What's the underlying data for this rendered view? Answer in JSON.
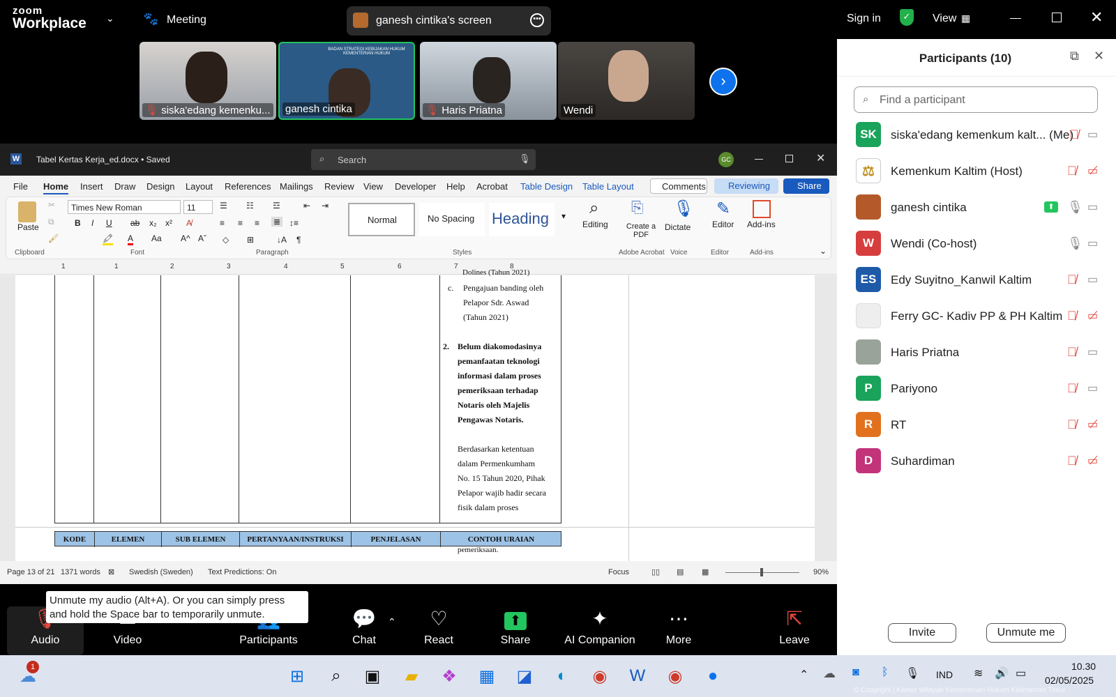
{
  "zoom": {
    "brand": "zoom",
    "app": "Workplace",
    "meeting_label": "Meeting",
    "share_title": "ganesh cintika's screen",
    "sign_in": "Sign in",
    "view": "View"
  },
  "videos": [
    {
      "name": "siska'edang kemenku..."
    },
    {
      "name": "ganesh cintika",
      "slide_text": "BADAN STRATEGI KEBIJAKAN HUKUM KEMENTERIAN HUKUM"
    },
    {
      "name": "Haris Priatna"
    },
    {
      "name": "Wendi"
    }
  ],
  "word": {
    "title": "Tabel Kertas Kerja_ed.docx • Saved",
    "search_placeholder": "Search",
    "avatar": "GC",
    "menu": [
      "File",
      "Home",
      "Insert",
      "Draw",
      "Design",
      "Layout",
      "References",
      "Mailings",
      "Review",
      "View",
      "Developer",
      "Help",
      "Acrobat",
      "Table Design",
      "Table Layout"
    ],
    "comments": "Comments",
    "reviewing": "Reviewing",
    "share": "Share",
    "font": "Times New Roman",
    "size": "11",
    "groups": {
      "clipboard": "Clipboard",
      "font": "Font",
      "paragraph": "Paragraph",
      "styles": "Styles",
      "adobe": "Adobe Acrobat",
      "voice": "Voice",
      "editor": "Editor",
      "addins": "Add-ins"
    },
    "paste": "Paste",
    "styles": [
      "Normal",
      "No Spacing",
      "Heading"
    ],
    "editing": "Editing",
    "create_pdf": "Create a PDF",
    "dictate": "Dictate",
    "editor_btn": "Editor",
    "addins_btn": "Add-ins",
    "ruler_nums": [
      "1",
      "1",
      "2",
      "3",
      "4",
      "5",
      "6",
      "7",
      "8"
    ],
    "doc": {
      "cut_line": "Dolines (Tahun 2021)",
      "item_c_label": "c.",
      "item_c_lines": [
        "Pengajuan banding oleh",
        "Pelapor Sdr. Aswad",
        "(Tahun 2021)"
      ],
      "item2_num": "2.",
      "item2_lines": [
        "Belum diakomodasinya",
        "pemanfaatan teknologi",
        "informasi dalam proses",
        "pemeriksaan terhadap",
        "Notaris oleh Majelis",
        "Pengawas Notaris."
      ],
      "para_lines": [
        "Berdasarkan ketentuan",
        "dalam Permenkumham",
        "No. 15 Tahun 2020, Pihak",
        "Pelapor wajib hadir secara",
        "fisik dalam proses"
      ],
      "headers": [
        "KODE",
        "ELEMEN",
        "SUB ELEMEN",
        "PERTANYAAN/INSTRUKSI",
        "PENJELASAN",
        "CONTOH URAIAN"
      ],
      "continued": "pemeriksaan."
    },
    "status": {
      "page": "Page 13 of 21",
      "words": "1371 words",
      "lang": "Swedish (Sweden)",
      "predictions": "Text Predictions: On",
      "focus": "Focus",
      "zoom": "90%"
    }
  },
  "tooltip": "Unmute my audio (Alt+A). Or you can simply press and hold the Space bar to temporarily unmute.",
  "toolbar": {
    "audio": "Audio",
    "video": "Video",
    "participants": "Participants",
    "participants_count": "10",
    "chat": "Chat",
    "react": "React",
    "share": "Share",
    "ai": "AI Companion",
    "more": "More",
    "leave": "Leave"
  },
  "panel": {
    "title": "Participants (10)",
    "search_placeholder": "Find a participant",
    "invite": "Invite",
    "unmute": "Unmute me"
  },
  "participants": [
    {
      "initials": "SK",
      "name": "siska'edang kemenkum kalt... (Me)",
      "color": "#1aa35a",
      "mic": "off",
      "video": "on"
    },
    {
      "initials": "",
      "name": "Kemenkum Kaltim (Host)",
      "color": "#ffffff",
      "mic": "off",
      "video": "off"
    },
    {
      "initials": "",
      "name": "ganesh cintika",
      "color": "#b45a2a",
      "mic": "on",
      "video": "on",
      "sharing": true
    },
    {
      "initials": "W",
      "name": "Wendi (Co-host)",
      "color": "#d63d3d",
      "mic": "on",
      "video": "on"
    },
    {
      "initials": "ES",
      "name": "Edy Suyitno_Kanwil Kaltim",
      "color": "#1e5aa8",
      "mic": "off",
      "video": "on"
    },
    {
      "initials": "",
      "name": "Ferry GC- Kadiv PP & PH Kaltim",
      "color": "#eeeeee",
      "mic": "off",
      "video": "off"
    },
    {
      "initials": "",
      "name": "Haris Priatna",
      "color": "#9aa39a",
      "mic": "off",
      "video": "on"
    },
    {
      "initials": "P",
      "name": "Pariyono",
      "color": "#1aa35a",
      "mic": "off",
      "video": "on"
    },
    {
      "initials": "R",
      "name": "RT",
      "color": "#e2711d",
      "mic": "off",
      "video": "off"
    },
    {
      "initials": "D",
      "name": "Suhardiman",
      "color": "#c2337a",
      "mic": "off",
      "video": "off"
    }
  ],
  "taskbar": {
    "notif": "1",
    "lang": "IND",
    "time": "10.30",
    "date": "02/05/2025",
    "watermark": "© Copyright | Kantor Wilayah Kementerian Hukum Kalimantan Timur"
  }
}
